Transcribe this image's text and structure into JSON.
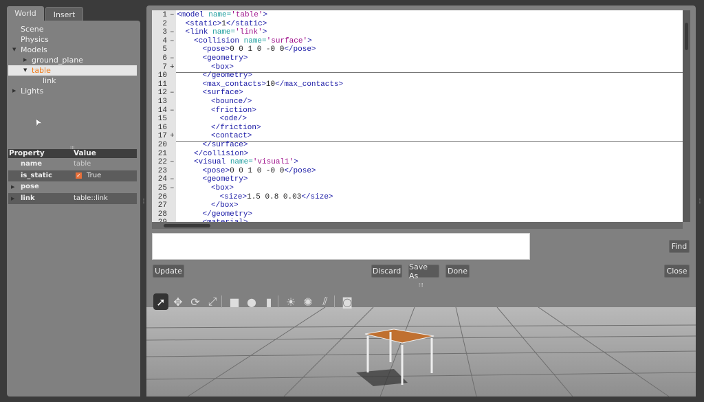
{
  "tabs": [
    "World",
    "Insert"
  ],
  "tree": [
    {
      "label": "Scene",
      "depth": 0,
      "arrow": ""
    },
    {
      "label": "Physics",
      "depth": 0,
      "arrow": ""
    },
    {
      "label": "Models",
      "depth": 0,
      "arrow": "down"
    },
    {
      "label": "ground_plane",
      "depth": 1,
      "arrow": "right"
    },
    {
      "label": "table",
      "depth": 1,
      "arrow": "down",
      "selected": true
    },
    {
      "label": "link",
      "depth": 2,
      "arrow": ""
    },
    {
      "label": "Lights",
      "depth": 0,
      "arrow": "right"
    }
  ],
  "properties": {
    "header": [
      "Property",
      "Value"
    ],
    "rows": [
      {
        "name": "name",
        "value": "table",
        "arrow": false
      },
      {
        "name": "is_static",
        "value": "True",
        "checkbox": true,
        "arrow": false
      },
      {
        "name": "pose",
        "value": "",
        "arrow": true
      },
      {
        "name": "link",
        "value": "table::link",
        "arrow": true
      }
    ]
  },
  "code": [
    {
      "n": "1",
      "f": "–",
      "i": 0,
      "s": [
        [
          "t",
          "<model "
        ],
        [
          "a",
          "name="
        ],
        [
          "v",
          "'table'"
        ],
        [
          "t",
          ">"
        ]
      ]
    },
    {
      "n": "2",
      "f": "",
      "i": 1,
      "s": [
        [
          "t",
          "<static>"
        ],
        [
          "p",
          "1"
        ],
        [
          "t",
          "</static>"
        ]
      ]
    },
    {
      "n": "3",
      "f": "–",
      "i": 1,
      "s": [
        [
          "t",
          "<link "
        ],
        [
          "a",
          "name="
        ],
        [
          "v",
          "'link'"
        ],
        [
          "t",
          ">"
        ]
      ]
    },
    {
      "n": "4",
      "f": "–",
      "i": 2,
      "s": [
        [
          "t",
          "<collision "
        ],
        [
          "a",
          "name="
        ],
        [
          "v",
          "'surface'"
        ],
        [
          "t",
          ">"
        ]
      ]
    },
    {
      "n": "5",
      "f": "",
      "i": 3,
      "s": [
        [
          "t",
          "<pose>"
        ],
        [
          "p",
          "0 0 1 0 -0 0"
        ],
        [
          "t",
          "</pose>"
        ]
      ]
    },
    {
      "n": "6",
      "f": "–",
      "i": 3,
      "s": [
        [
          "t",
          "<geometry>"
        ]
      ]
    },
    {
      "n": "7",
      "f": "+",
      "i": 4,
      "s": [
        [
          "t",
          "<box>"
        ]
      ],
      "sep": true
    },
    {
      "n": "10",
      "f": "",
      "i": 3,
      "s": [
        [
          "t",
          "</geometry>"
        ]
      ]
    },
    {
      "n": "11",
      "f": "",
      "i": 3,
      "s": [
        [
          "t",
          "<max_contacts>"
        ],
        [
          "p",
          "10"
        ],
        [
          "t",
          "</max_contacts>"
        ]
      ]
    },
    {
      "n": "12",
      "f": "–",
      "i": 3,
      "s": [
        [
          "t",
          "<surface>"
        ]
      ]
    },
    {
      "n": "13",
      "f": "",
      "i": 4,
      "s": [
        [
          "t",
          "<bounce/>"
        ]
      ]
    },
    {
      "n": "14",
      "f": "–",
      "i": 4,
      "s": [
        [
          "t",
          "<friction>"
        ]
      ]
    },
    {
      "n": "15",
      "f": "",
      "i": 5,
      "s": [
        [
          "t",
          "<ode/>"
        ]
      ]
    },
    {
      "n": "16",
      "f": "",
      "i": 4,
      "s": [
        [
          "t",
          "</friction>"
        ]
      ]
    },
    {
      "n": "17",
      "f": "+",
      "i": 4,
      "s": [
        [
          "t",
          "<contact>"
        ]
      ],
      "sep": true
    },
    {
      "n": "20",
      "f": "",
      "i": 3,
      "s": [
        [
          "t",
          "</surface>"
        ]
      ]
    },
    {
      "n": "21",
      "f": "",
      "i": 2,
      "s": [
        [
          "t",
          "</collision>"
        ]
      ]
    },
    {
      "n": "22",
      "f": "–",
      "i": 2,
      "s": [
        [
          "t",
          "<visual "
        ],
        [
          "a",
          "name="
        ],
        [
          "v",
          "'visual1'"
        ],
        [
          "t",
          ">"
        ]
      ]
    },
    {
      "n": "23",
      "f": "",
      "i": 3,
      "s": [
        [
          "t",
          "<pose>"
        ],
        [
          "p",
          "0 0 1 0 -0 0"
        ],
        [
          "t",
          "</pose>"
        ]
      ]
    },
    {
      "n": "24",
      "f": "–",
      "i": 3,
      "s": [
        [
          "t",
          "<geometry>"
        ]
      ]
    },
    {
      "n": "25",
      "f": "–",
      "i": 4,
      "s": [
        [
          "t",
          "<box>"
        ]
      ]
    },
    {
      "n": "26",
      "f": "",
      "i": 5,
      "s": [
        [
          "t",
          "<size>"
        ],
        [
          "p",
          "1.5 0.8 0.03"
        ],
        [
          "t",
          "</size>"
        ]
      ]
    },
    {
      "n": "27",
      "f": "",
      "i": 4,
      "s": [
        [
          "t",
          "</box>"
        ]
      ]
    },
    {
      "n": "28",
      "f": "",
      "i": 3,
      "s": [
        [
          "t",
          "</geometry>"
        ]
      ]
    },
    {
      "n": "29",
      "f": "",
      "i": 3,
      "s": [
        [
          "t",
          "<material>"
        ]
      ]
    }
  ],
  "search": {
    "value": ""
  },
  "buttons": {
    "find": "Find",
    "update": "Update",
    "discard": "Discard",
    "save_as": "Save As",
    "done": "Done",
    "close": "Close"
  },
  "toolbar": [
    "select-arrow-icon",
    "translate-icon",
    "rotate-icon",
    "scale-icon",
    "box-icon",
    "sphere-icon",
    "cylinder-icon",
    "point-light-icon",
    "spot-light-icon",
    "directional-light-icon",
    "screenshot-icon"
  ],
  "colors": {
    "selected_text": "#f07d1a",
    "tag": "#1a1aa6",
    "attr": "#1a9c9c",
    "value": "#a0148c"
  }
}
